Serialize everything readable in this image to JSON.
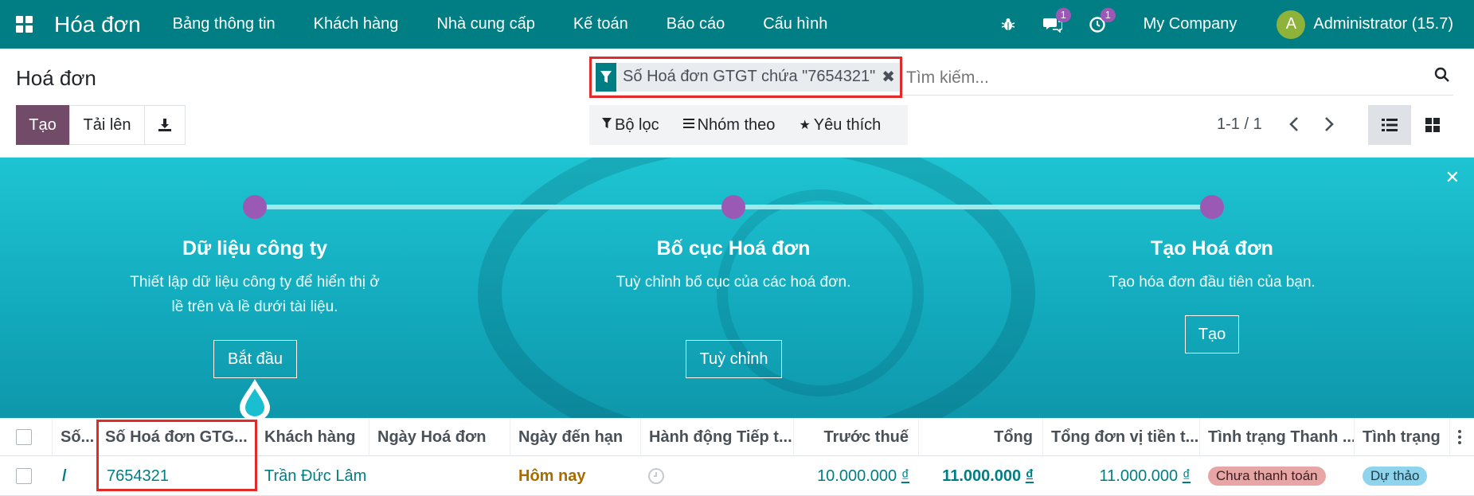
{
  "navbar": {
    "app_name": "Hóa đơn",
    "menu": [
      "Bảng thông tin",
      "Khách hàng",
      "Nhà cung cấp",
      "Kế toán",
      "Báo cáo",
      "Cấu hình"
    ],
    "messages_count": "1",
    "activities_count": "1",
    "company": "My Company",
    "avatar_letter": "A",
    "user": "Administrator (15.7)",
    "accent_color": "#017e84"
  },
  "control": {
    "title": "Hoá đơn",
    "create_label": "Tạo",
    "upload_label": "Tải lên",
    "facet_text": "Số Hoá đơn GTGT chứa \"7654321\"",
    "search_placeholder": "Tìm kiếm...",
    "filter_label": "Bộ lọc",
    "group_label": "Nhóm theo",
    "favorite_label": "Yêu thích",
    "pager": "1-1 / 1"
  },
  "onboarding": {
    "steps": [
      {
        "title": "Dữ liệu công ty",
        "desc": "Thiết lập dữ liệu công ty để hiển thị ở lề trên và lề dưới tài liệu.",
        "button": "Bắt đầu"
      },
      {
        "title": "Bố cục Hoá đơn",
        "desc": "Tuỳ chỉnh bố cục của các hoá đơn.",
        "button": "Tuỳ chỉnh"
      },
      {
        "title": "Tạo Hoá đơn",
        "desc": "Tạo hóa đơn đầu tiên của bạn.",
        "button": "Tạo"
      }
    ]
  },
  "table": {
    "columns": [
      "Số...",
      "Số Hoá đơn GTG...",
      "Khách hàng",
      "Ngày Hoá đơn",
      "Ngày đến hạn",
      "Hành động Tiếp t...",
      "Trước thuế",
      "Tổng",
      "Tổng đơn vị tiền t...",
      "Tình trạng Thanh ...",
      "Tình trạng"
    ],
    "rows": [
      {
        "number": "/",
        "vat_number": "7654321",
        "customer": "Trần Đức Lâm",
        "invoice_date": "",
        "due_date": "Hôm nay",
        "untaxed": "10.000.000",
        "total": "11.000.000",
        "total_currency": "11.000.000",
        "currency_symbol": "₫",
        "payment_status": "Chưa thanh toán",
        "status": "Dự thảo"
      }
    ]
  }
}
